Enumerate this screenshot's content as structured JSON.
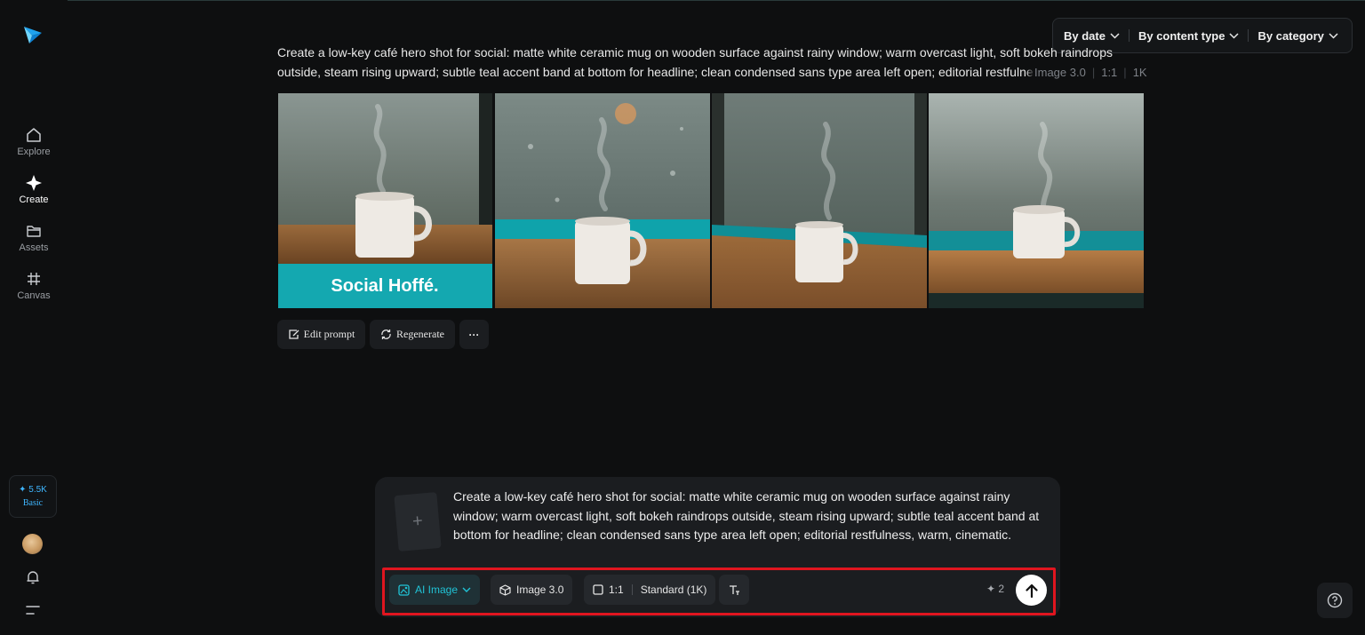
{
  "sidebar": {
    "items": [
      {
        "label": "Explore",
        "icon": "home-icon"
      },
      {
        "label": "Create",
        "icon": "sparkle-icon"
      },
      {
        "label": "Assets",
        "icon": "folder-icon"
      },
      {
        "label": "Canvas",
        "icon": "grid-icon"
      }
    ],
    "credits": {
      "amount": "✦ 5.5K",
      "plan": "Basic"
    }
  },
  "filters": {
    "by_date": "By date",
    "by_content_type": "By content type",
    "by_category": "By category"
  },
  "generation": {
    "prompt": "Create a low-key café hero shot for social: matte white ceramic mug on wooden surface against rainy window; warm overcast light, soft bokeh raindrops outside, steam rising upward; subtle teal accent band at bottom for headline; clean condensed sans type area left open; editorial restfulness, warm, cinematic.",
    "model": "Image 3.0",
    "ratio": "1:1",
    "resolution": "1K",
    "images": [
      {
        "banner_text": "Social  Hoffé."
      },
      {},
      {},
      {}
    ],
    "actions": {
      "edit": "Edit prompt",
      "regenerate": "Regenerate",
      "more": "···"
    }
  },
  "composer": {
    "add_reference": "+",
    "prompt": "Create a low-key café hero shot for social: matte white ceramic mug on wooden surface against rainy window; warm overcast light, soft bokeh raindrops outside, steam rising upward; subtle teal accent band at bottom for headline; clean condensed sans type area left open; editorial restfulness, warm, cinematic.",
    "mode": "AI Image",
    "model": "Image 3.0",
    "ratio": "1:1",
    "quality": "Standard (1K)",
    "cost": "✦ 2"
  },
  "colors": {
    "accent": "#20c3d6",
    "teal_band": "#14a8b0",
    "highlight": "#e0151f"
  }
}
